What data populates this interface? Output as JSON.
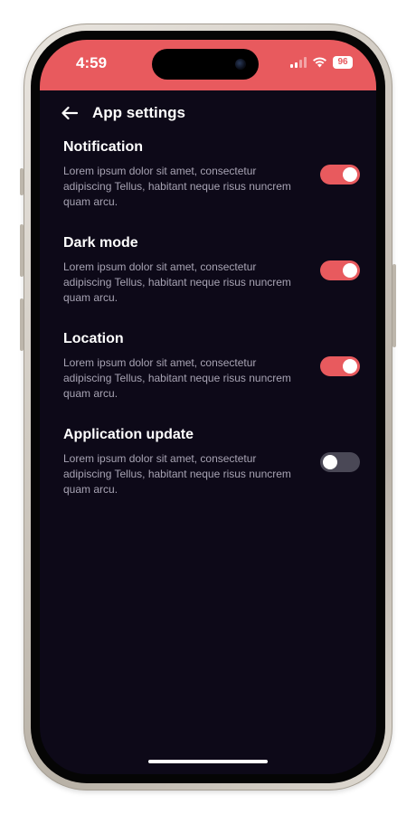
{
  "status_bar": {
    "time": "4:59",
    "battery": "96",
    "color": "#e85a5e"
  },
  "header": {
    "back_icon": "arrow-left-icon",
    "title": "App settings"
  },
  "settings": [
    {
      "title": "Notification",
      "description": "Lorem ipsum dolor sit amet, consectetur adipiscing Tellus, habitant neque risus nuncrem quam arcu.",
      "enabled": true
    },
    {
      "title": "Dark mode",
      "description": "Lorem ipsum dolor sit amet, consectetur adipiscing Tellus, habitant neque risus nuncrem quam arcu.",
      "enabled": true
    },
    {
      "title": "Location",
      "description": "Lorem ipsum dolor sit amet, consectetur adipiscing Tellus, habitant neque risus nuncrem quam arcu.",
      "enabled": true
    },
    {
      "title": "Application update",
      "description": "Lorem ipsum dolor sit amet, consectetur adipiscing Tellus, habitant neque risus nuncrem quam arcu.",
      "enabled": false
    }
  ],
  "colors": {
    "accent": "#e85a5e",
    "background": "#0d0918",
    "toggle_off": "#4a4856"
  }
}
